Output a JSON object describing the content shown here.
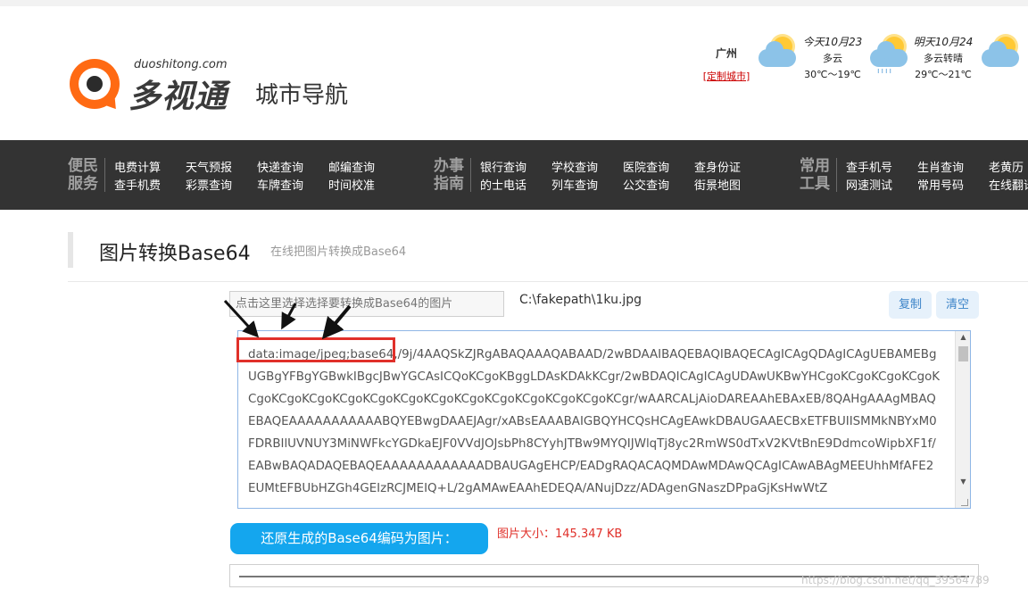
{
  "site": {
    "domain": "duoshitong.com",
    "name": "多视通",
    "section": "城市导航"
  },
  "weather": {
    "city": "广州",
    "customize_link": "定制城市",
    "today": {
      "day": "今天10月23",
      "condition": "多云",
      "temp": "30℃～19℃",
      "icon": "sun-cloud-icon"
    },
    "tomorrow": {
      "day": "明天10月24",
      "condition": "多云转晴",
      "temp": "29℃～21℃",
      "icon": "rain-cloud-icon"
    },
    "extra_icon": "sun-cloud-icon"
  },
  "nav": {
    "groups": [
      {
        "title_top": "便民",
        "title_bottom": "服务",
        "items": [
          [
            "电费计算",
            "查手机费"
          ],
          [
            "天气预报",
            "彩票查询"
          ],
          [
            "快递查询",
            "车牌查询"
          ],
          [
            "邮编查询",
            "时间校准"
          ]
        ]
      },
      {
        "title_top": "办事",
        "title_bottom": "指南",
        "items": [
          [
            "银行查询",
            "的士电话"
          ],
          [
            "学校查询",
            "列车查询"
          ],
          [
            "医院查询",
            "公交查询"
          ],
          [
            "查身份证",
            "街景地图"
          ]
        ]
      },
      {
        "title_top": "常用",
        "title_bottom": "工具",
        "items": [
          [
            "查手机号",
            "网速测试"
          ],
          [
            "生肖查询",
            "常用号码"
          ],
          [
            "老黄历",
            "在线翻译"
          ]
        ]
      }
    ]
  },
  "page": {
    "title": "图片转换Base64",
    "subtitle": "在线把图片转换成Base64"
  },
  "tool": {
    "file_placeholder": "点击这里选择选择要转换成Base64的图片",
    "file_path": "C:\\fakepath\\1ku.jpg",
    "copy_label": "复制",
    "clear_label": "清空",
    "base64_text": "data:image/jpeg;base64,/9j/4AAQSkZJRgABAQAAAQABAAD/2wBDAAIBAQEBAQIBAQECAgICAgQDAgICAgUEBAMEBgUGBgYFBgYGBwkIBgcJBwYGCAsICQoKCgoKBggLDAsKDAkKCgr/2wBDAQICAgICAgUDAwUKBwYHCgoKCgoKCgoKCgoKCgoKCgoKCgoKCgoKCgoKCgoKCgoKCgoKCgoKCgoKCgoKCgoKCgr/wAARCALjAioDAREAAhEBAxEB/8QAHgAAAgMBAQEBAQEAAAAAAAAAAABQYEBwgDAAEJAgr/xABsEAAABAIGBQYHCQsHCAgEAwkDBAUGAAECBxETFBUIISMMkNBYxM0FDRBIlUVNUY3MiNWFkcYGDkaEJF0VVdJOJsbPh8CYyhJTBw9MYQIJWlqTj8yc2RmWS0dTxV2KVtBnE9DdmcoWipbXF1f/EABwBAQADAQEBAQEAAAAAAAAAAAADBAUGAgEHCP/EADgRAQACAQMDAwMDAwQCAgICAwABAgMEEUhhMfAFE2EUMtEFBUbHZGh4GEIzRCJMEIQ+L/2gAMAwEAAhEDEQA/ANujDzz/ADAgenGNaszDPpaGjKsHwWtZ",
    "convert_button": "还原生成的Base64编码为图片：",
    "size_label": "图片大小：145.347 KB"
  },
  "watermark": "https://blog.csdn.net/qq_39564789"
}
